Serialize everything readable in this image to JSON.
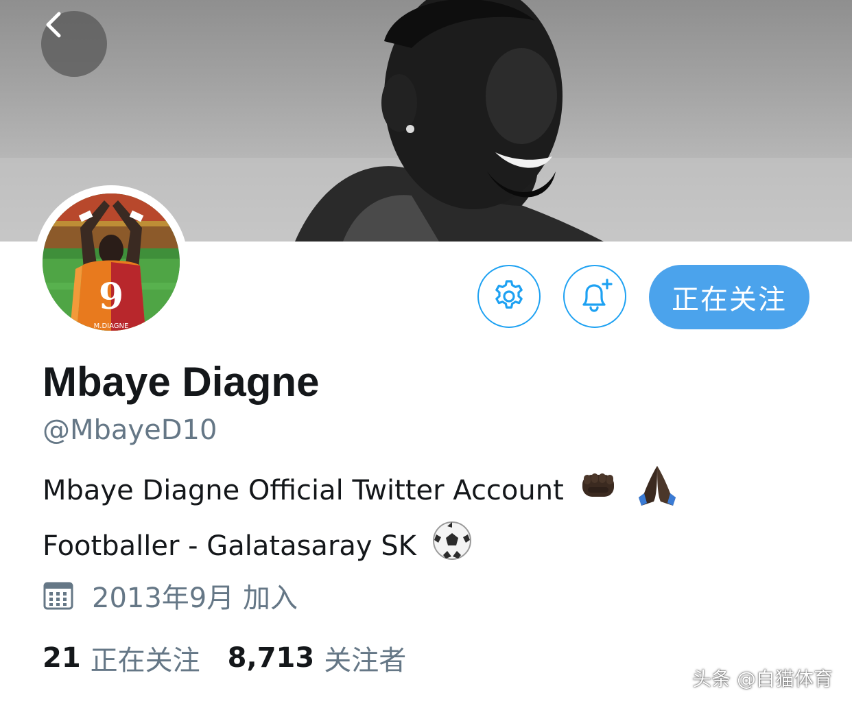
{
  "profile": {
    "name": "Mbaye Diagne",
    "handle": "@MbayeD10",
    "bio_line1": "Mbaye Diagne Official Twitter Account",
    "bio_line2": "Footballer - Galatasaray SK",
    "joined": "2013年9月 加入",
    "avatar_jersey_number": "9",
    "avatar_jersey_name": "M.DIAGNE"
  },
  "actions": {
    "follow_label": "正在关注",
    "settings_icon": "gear-icon",
    "notify_icon": "bell-plus-icon",
    "back_icon": "chevron-left-icon"
  },
  "stats": {
    "following_count": "21",
    "following_label": "正在关注",
    "followers_count": "8,713",
    "followers_label": "关注者"
  },
  "watermark": "头条 @白猫体育",
  "colors": {
    "accent": "#1da1f2",
    "follow_button": "#4ba3ec",
    "text_primary": "#14171a",
    "text_secondary": "#657786"
  }
}
